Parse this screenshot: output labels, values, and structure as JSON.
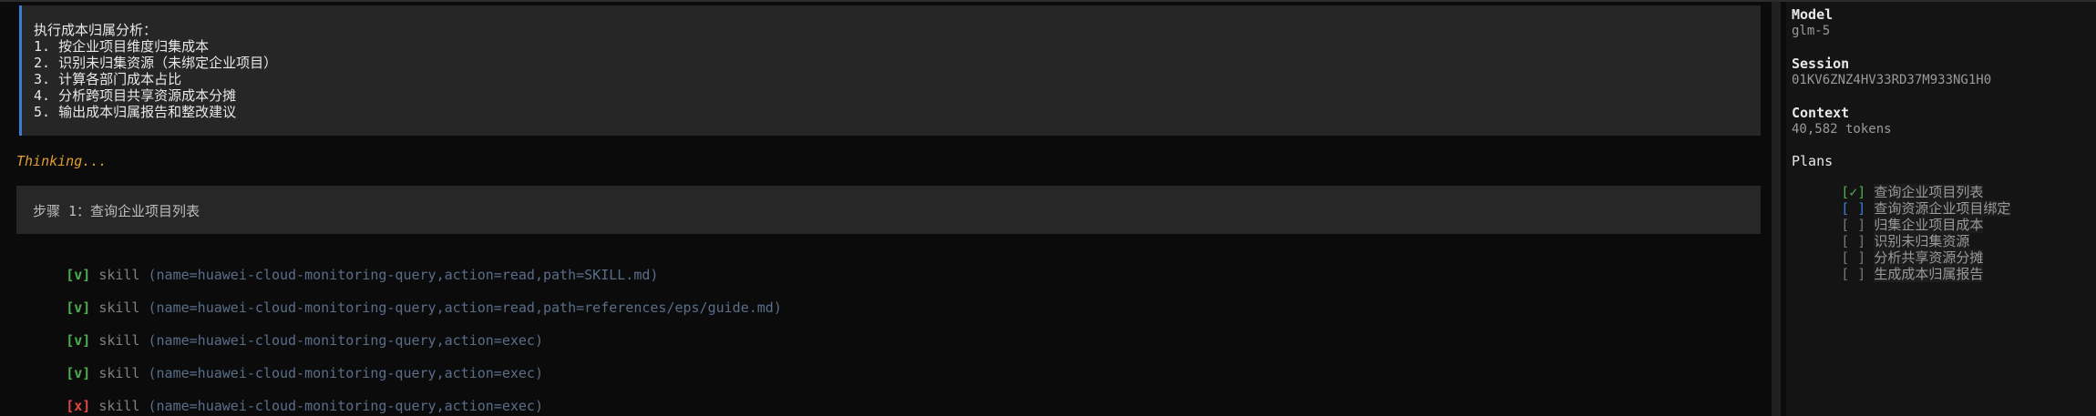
{
  "task": {
    "lines": [
      "执行成本归属分析：",
      "1. 按企业项目维度归集成本",
      "2. 识别未归集资源（未绑定企业项目）",
      "3. 计算各部门成本占比",
      "4. 分析跨项目共享资源成本分摊",
      "5. 输出成本归属报告和整改建议"
    ]
  },
  "thinking": "Thinking...",
  "step": {
    "title": "步骤 1：查询企业项目列表"
  },
  "tool_calls": [
    {
      "status": "[v]",
      "state": "ok",
      "name": "skill",
      "args": "(name=huawei-cloud-monitoring-query,action=read,path=SKILL.md)"
    },
    {
      "status": "[v]",
      "state": "ok",
      "name": "skill",
      "args": "(name=huawei-cloud-monitoring-query,action=read,path=references/eps/guide.md)"
    },
    {
      "status": "[v]",
      "state": "ok",
      "name": "skill",
      "args": "(name=huawei-cloud-monitoring-query,action=exec)"
    },
    {
      "status": "[v]",
      "state": "ok",
      "name": "skill",
      "args": "(name=huawei-cloud-monitoring-query,action=exec)"
    },
    {
      "status": "[x]",
      "state": "fail",
      "name": "skill",
      "args": "(name=huawei-cloud-monitoring-query,action=exec)"
    }
  ],
  "sidebar": {
    "model_label": "Model",
    "model_value": "glm-5",
    "session_label": "Session",
    "session_value": "01KV6ZNZ4HV33RD37M933NG1H0",
    "context_label": "Context",
    "context_value": "40,582 tokens",
    "plans_label": "Plans",
    "plans": [
      {
        "box": "[✓]",
        "state": "done",
        "text": "查询企业项目列表"
      },
      {
        "box": "[ ]",
        "state": "active",
        "text": "查询资源企业项目绑定"
      },
      {
        "box": "[ ]",
        "state": "todo",
        "text": "归集企业项目成本"
      },
      {
        "box": "[ ]",
        "state": "todo",
        "text": "识别未归集资源"
      },
      {
        "box": "[ ]",
        "state": "todo",
        "text": "分析共享资源分摊"
      },
      {
        "box": "[ ]",
        "state": "todo",
        "text": "生成成本归属报告"
      }
    ]
  },
  "colors": {
    "accent": "#3a7bd5",
    "ok": "#4caf50",
    "fail": "#e04848",
    "thinking": "#e0a030"
  }
}
